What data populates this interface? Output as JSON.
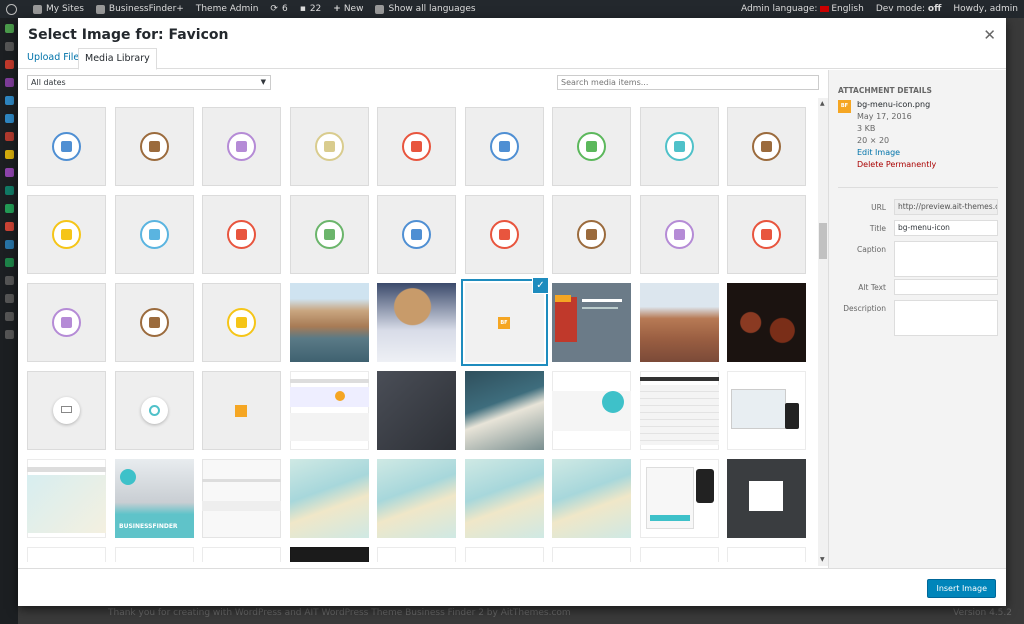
{
  "adminbar": {
    "my_sites": "My Sites",
    "site_name": "BusinessFinder+",
    "theme_admin": "Theme Admin",
    "updates_count": "6",
    "comments_count": "22",
    "new_label": "New",
    "languages": "Show all languages",
    "admin_language_label": "Admin language:",
    "admin_language_value": "English",
    "dev_mode_label": "Dev mode:",
    "dev_mode_value": "off",
    "howdy": "Howdy, admin"
  },
  "footer": {
    "thanks": "Thank you for creating with WordPress and AIT WordPress Theme Business Finder 2 by AitThemes.com",
    "version": "Version 4.5.2"
  },
  "modal": {
    "title": "Select Image for: Favicon",
    "close_icon": "close-icon",
    "tabs": [
      {
        "label": "Upload Files",
        "active": false
      },
      {
        "label": "Media Library",
        "active": true
      }
    ],
    "date_filter": "All dates",
    "search_placeholder": "Search media items...",
    "insert_button": "Insert Image"
  },
  "colors": {
    "accent": "#0073aa",
    "selection": "#1e8cbe",
    "button": "#0085ba",
    "delete": "#a00000"
  },
  "icon_rows": [
    [
      {
        "name": "building-icon",
        "color": "#4f8fd3"
      },
      {
        "name": "home-icon",
        "color": "#9b6b3d"
      },
      {
        "name": "music-icon",
        "color": "#b58bd6"
      },
      {
        "name": "boot-icon",
        "color": "#d9cc8e"
      },
      {
        "name": "person-icon",
        "color": "#e8553e"
      },
      {
        "name": "person-icon",
        "color": "#4f8fd3"
      },
      {
        "name": "dollar-icon",
        "color": "#5cb85c"
      },
      {
        "name": "ship-icon",
        "color": "#4fc1c9"
      },
      {
        "name": "gears-icon",
        "color": "#9b6b3d"
      }
    ],
    [
      {
        "name": "pipette-icon",
        "color": "#f5c518"
      },
      {
        "name": "phone-icon",
        "color": "#5ab4e0"
      },
      {
        "name": "heartbeat-icon",
        "color": "#e8553e"
      },
      {
        "name": "flask-icon",
        "color": "#6bb56b"
      },
      {
        "name": "user-card-icon",
        "color": "#4f8fd3"
      },
      {
        "name": "book-icon",
        "color": "#e8553e"
      },
      {
        "name": "briefcase-icon",
        "color": "#9b6b3d"
      },
      {
        "name": "chart-icon",
        "color": "#b58bd6"
      },
      {
        "name": "megaphone-icon",
        "color": "#e8553e"
      }
    ],
    [
      {
        "name": "flower-icon",
        "color": "#b58bd6"
      },
      {
        "name": "coffee-icon",
        "color": "#9b6b3d"
      },
      {
        "name": "star-icon",
        "color": "#f5c518"
      }
    ]
  ],
  "details": {
    "heading": "Attachment Details",
    "filename": "bg-menu-icon.png",
    "date": "May 17, 2016",
    "size": "3 KB",
    "dimensions": "20 × 20",
    "edit_link": "Edit Image",
    "delete_link": "Delete Permanently",
    "url_label": "URL",
    "url_value": "http://preview.ait-themes.club",
    "title_label": "Title",
    "title_value": "bg-menu-icon",
    "caption_label": "Caption",
    "alt_label": "Alt Text",
    "description_label": "Description"
  }
}
